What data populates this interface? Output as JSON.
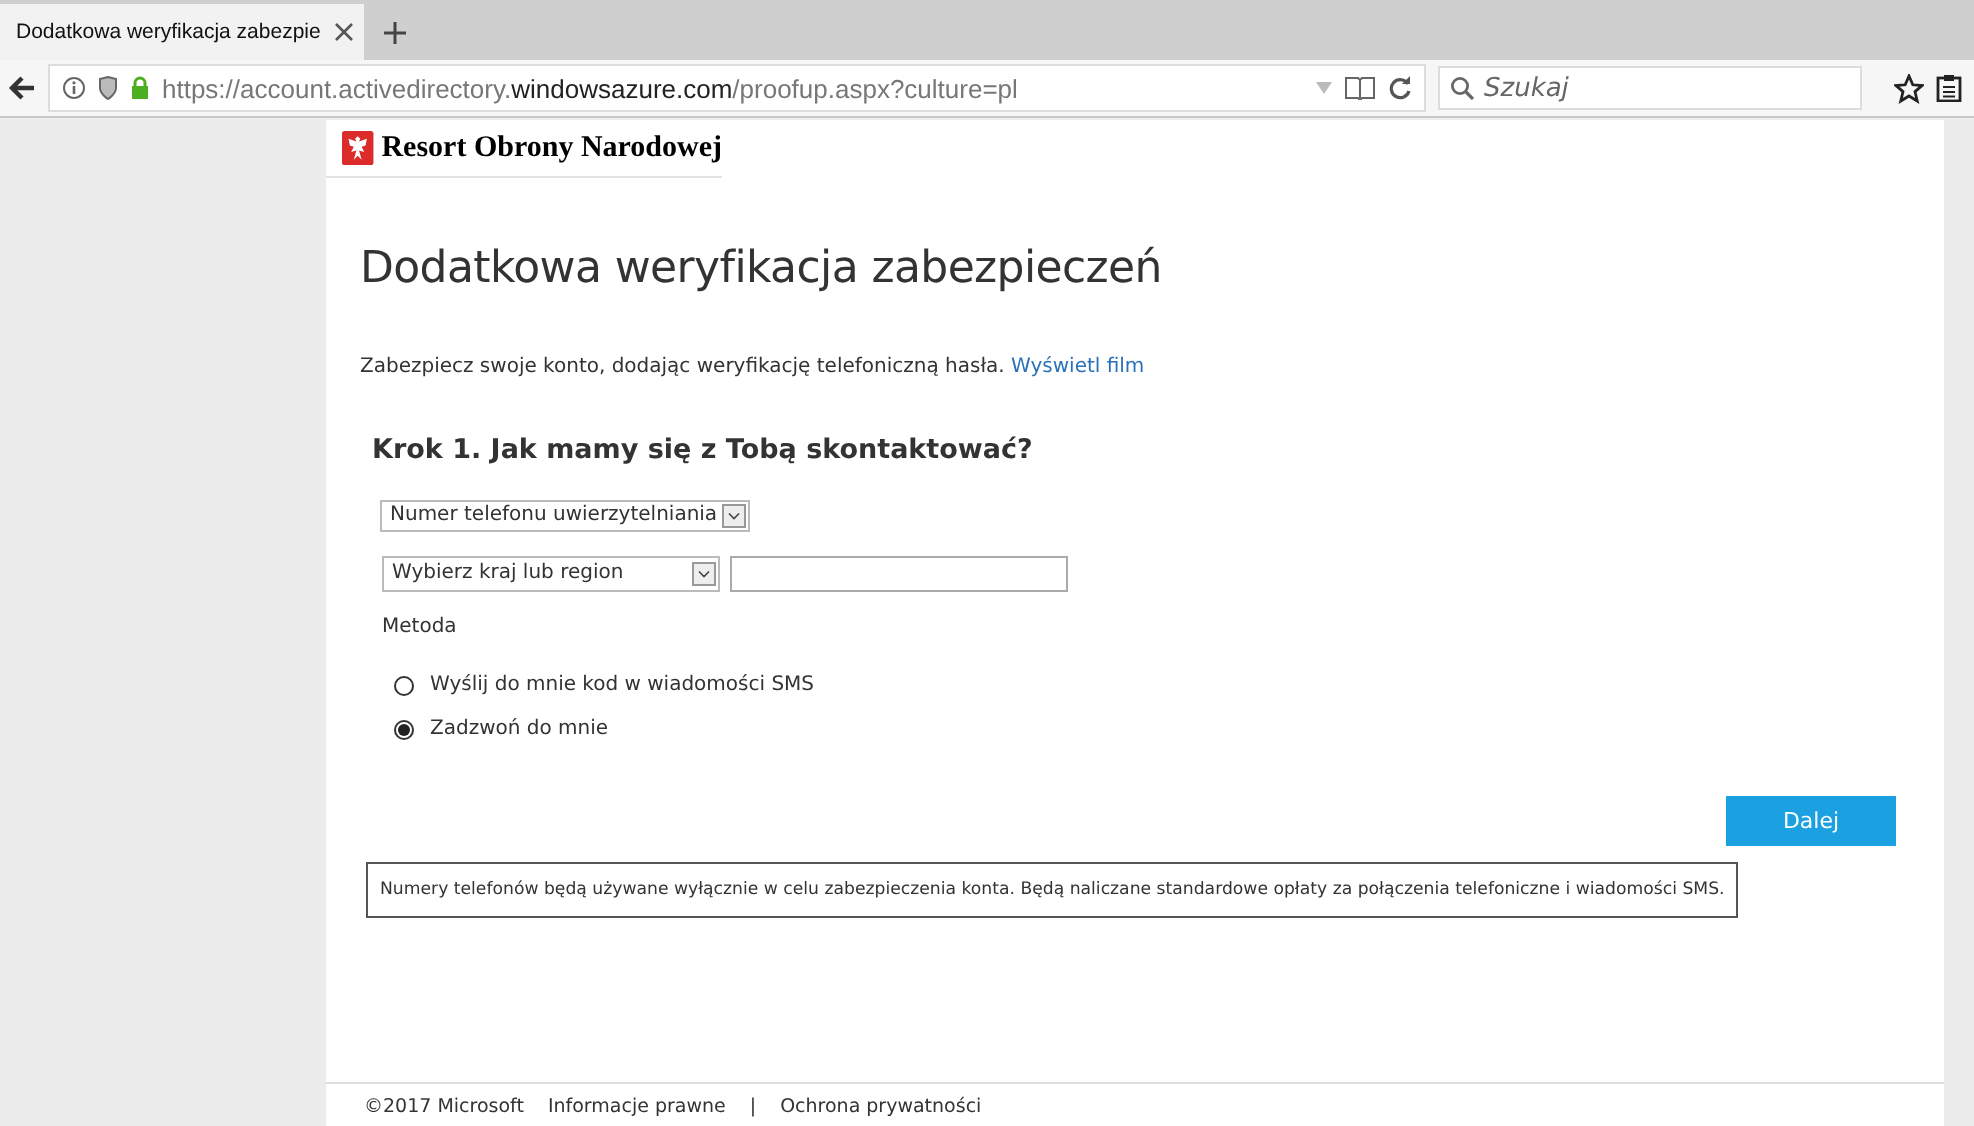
{
  "browser": {
    "tab": {
      "title": "Dodatkowa weryfikacja zabezpie"
    },
    "url": {
      "prefix": "https://account.activedirectory.",
      "domain": "windowsazure.com",
      "path": "/proofup.aspx?culture=pl"
    },
    "search": {
      "placeholder": "Szukaj"
    }
  },
  "header": {
    "logo_text": "Resort Obrony Narodowej"
  },
  "page": {
    "title": "Dodatkowa weryfikacja zabezpieczeń",
    "intro": "Zabezpiecz swoje konto, dodając weryfikację telefoniczną hasła.",
    "intro_link": "Wyświetl film",
    "step_heading": "Krok 1. Jak mamy się z Tobą skontaktować?",
    "contact_type": {
      "value": "Numer telefonu uwierzytelniania"
    },
    "country": {
      "value": "Wybierz kraj lub region"
    },
    "method_label": "Metoda",
    "methods": [
      {
        "label": "Wyślij do mnie kod w wiadomości SMS",
        "selected": false
      },
      {
        "label": "Zadzwoń do mnie",
        "selected": true
      }
    ],
    "next_button": "Dalej",
    "notice": "Numery telefonów będą używane wyłącznie w celu zabezpieczenia konta. Będą naliczane standardowe opłaty za połączenia telefoniczne i wiadomości SMS."
  },
  "footer": {
    "copyright": "©2017 Microsoft",
    "links": [
      "Informacje prawne",
      "Ochrona prywatności"
    ],
    "separator": "|"
  }
}
